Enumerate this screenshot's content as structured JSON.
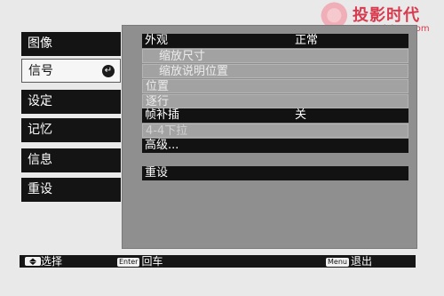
{
  "watermark": {
    "title": "投影时代",
    "url": "www.PjTime.com"
  },
  "sidebar": {
    "items": [
      {
        "label": "图像"
      },
      {
        "label": "信号",
        "selected": true,
        "enter_glyph": "↵"
      },
      {
        "label": "设定"
      },
      {
        "label": "记忆"
      },
      {
        "label": "信息"
      },
      {
        "label": "重设"
      }
    ]
  },
  "menu": {
    "rows": [
      {
        "label": "外观",
        "value": "正常",
        "state": "enabled"
      },
      {
        "label": "缩放尺寸",
        "state": "unavailable"
      },
      {
        "label": "缩放说明位置",
        "state": "unavailable"
      },
      {
        "label": "位置",
        "state": "unavailable"
      },
      {
        "label": "逐行",
        "state": "unavailable"
      },
      {
        "label": "帧补插",
        "value": "关",
        "state": "enabled"
      },
      {
        "label": "4-4下拉",
        "state": "disabled"
      },
      {
        "label": "高级...",
        "state": "enabled"
      },
      {
        "label": "重设",
        "state": "enabled"
      }
    ]
  },
  "footer": {
    "select_label": "选择",
    "enter_key": "Enter",
    "enter_label": "回车",
    "menu_key": "Menu",
    "menu_label": "退出"
  },
  "colors": {
    "bar": "#141414",
    "panel": "#8f8f8f",
    "watermark": "#d83a4e"
  }
}
